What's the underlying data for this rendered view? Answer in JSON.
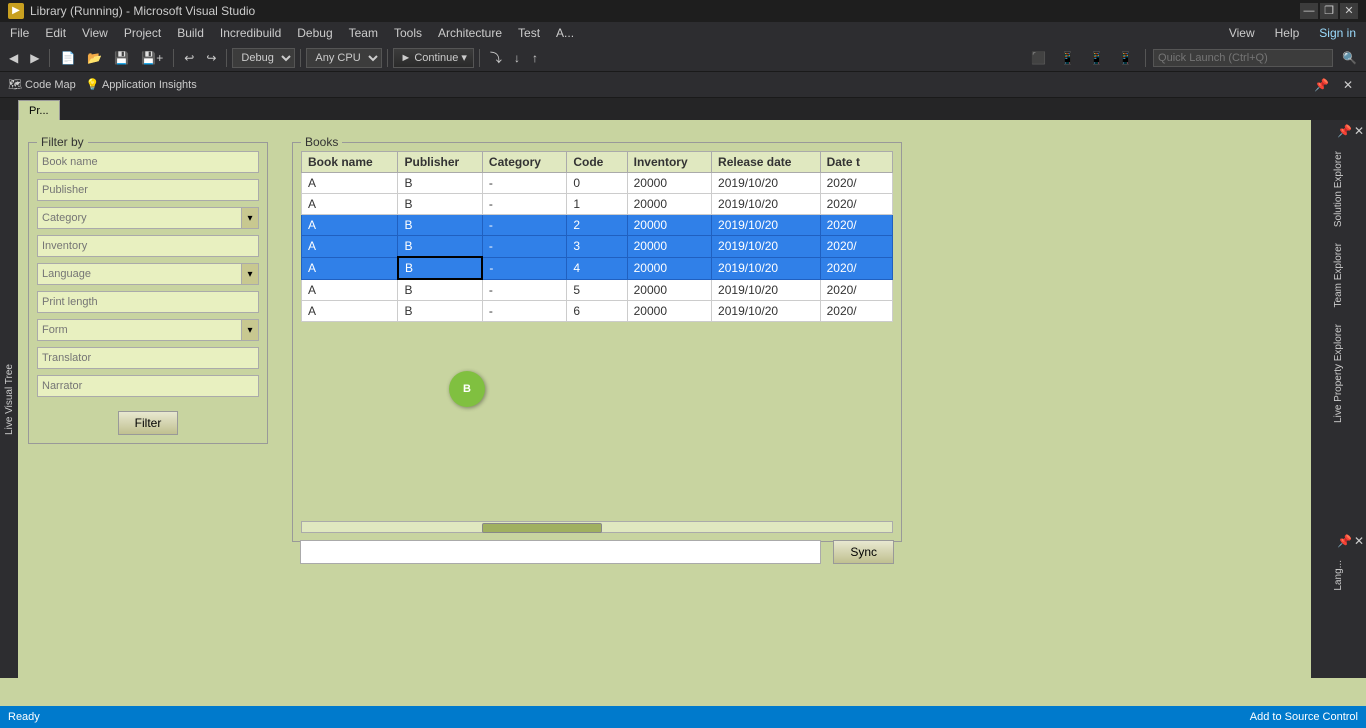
{
  "titleBar": {
    "title": "Library (Running) - Microsoft Visual Studio",
    "icon": "VS",
    "controls": [
      "—",
      "❐",
      "✕"
    ]
  },
  "menuBar": {
    "items": [
      "File",
      "Edit",
      "View",
      "Project",
      "Build",
      "Incredibuild",
      "Debug",
      "Team",
      "Tools",
      "Architecture",
      "Test",
      "A...",
      "View",
      "Help"
    ]
  },
  "toolbar": {
    "debugMode": "Debug",
    "platform": "Any CPU",
    "continueLabel": "► Continue",
    "codemap": "Code Map",
    "appInsights": "Application Insights"
  },
  "searchBar": {
    "placeholder": "Quick Launch (Ctrl+Q)"
  },
  "tabBar": {
    "tabs": [
      {
        "label": "Pr...",
        "active": true
      }
    ]
  },
  "filterPanel": {
    "title": "Filter by",
    "fields": [
      {
        "id": "bookname",
        "placeholder": "Book name",
        "hasDropdown": false
      },
      {
        "id": "publisher",
        "placeholder": "Publisher",
        "hasDropdown": false
      },
      {
        "id": "category",
        "placeholder": "Category",
        "hasDropdown": true
      },
      {
        "id": "inventory",
        "placeholder": "Inventory",
        "hasDropdown": false
      },
      {
        "id": "language",
        "placeholder": "Language",
        "hasDropdown": true
      },
      {
        "id": "printlength",
        "placeholder": "Print length",
        "hasDropdown": false
      },
      {
        "id": "form",
        "placeholder": "Form",
        "hasDropdown": true
      },
      {
        "id": "translator",
        "placeholder": "Translator",
        "hasDropdown": false
      },
      {
        "id": "narrator",
        "placeholder": "Narrator",
        "hasDropdown": false
      }
    ],
    "filterBtn": "Filter"
  },
  "booksPanel": {
    "title": "Books",
    "columns": [
      "Book name",
      "Publisher",
      "Category",
      "Code",
      "Inventory",
      "Release date",
      "Date t"
    ],
    "rows": [
      {
        "bookName": "A",
        "publisher": "B",
        "category": "-",
        "code": "0",
        "inventory": "20000",
        "releaseDate": "2019/10/20",
        "dateT": "2020/",
        "selected": false
      },
      {
        "bookName": "A",
        "publisher": "B",
        "category": "-",
        "code": "1",
        "inventory": "20000",
        "releaseDate": "2019/10/20",
        "dateT": "2020/",
        "selected": false
      },
      {
        "bookName": "A",
        "publisher": "B",
        "category": "-",
        "code": "2",
        "inventory": "20000",
        "releaseDate": "2019/10/20",
        "dateT": "2020/",
        "selected": true
      },
      {
        "bookName": "A",
        "publisher": "B",
        "category": "-",
        "code": "3",
        "inventory": "20000",
        "releaseDate": "2019/10/20",
        "dateT": "2020/",
        "selected": true
      },
      {
        "bookName": "A",
        "publisher": "B",
        "category": "-",
        "code": "4",
        "inventory": "20000",
        "releaseDate": "2019/10/20",
        "dateT": "2020/",
        "selected": true,
        "activeCell": true
      },
      {
        "bookName": "A",
        "publisher": "B",
        "category": "-",
        "code": "5",
        "inventory": "20000",
        "releaseDate": "2019/10/20",
        "dateT": "2020/",
        "selected": false
      },
      {
        "bookName": "A",
        "publisher": "B",
        "category": "-",
        "code": "6",
        "inventory": "20000",
        "releaseDate": "2019/10/20",
        "dateT": "2020/",
        "selected": false
      }
    ],
    "dragCircle": "B"
  },
  "bottomArea": {
    "syncBtn": "Sync"
  },
  "rightPanels": [
    {
      "label": "Solution Explorer",
      "active": false
    },
    {
      "label": "Team Explorer",
      "active": false
    },
    {
      "label": "Live Property Explorer",
      "active": false
    }
  ],
  "statusBar": {
    "ready": "Ready",
    "rightItems": [
      "Add to Source Control"
    ]
  }
}
